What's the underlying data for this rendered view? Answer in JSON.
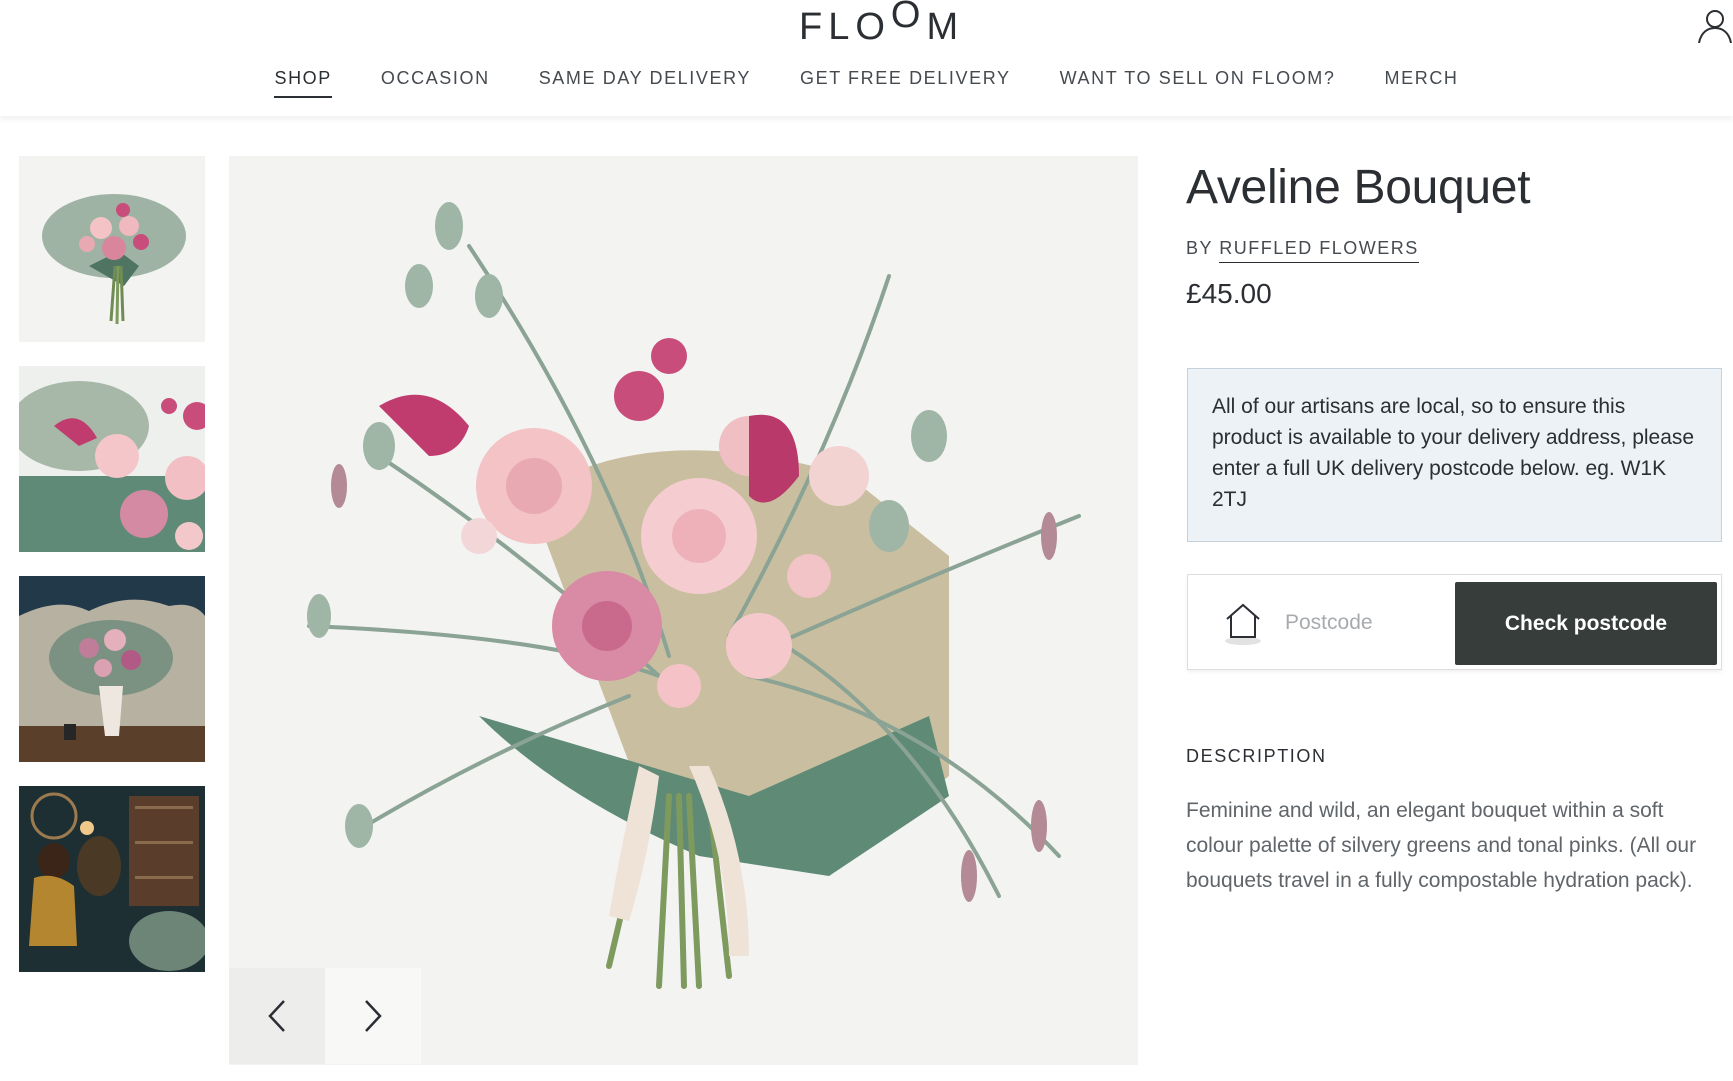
{
  "brand": {
    "logo_text": "FLOOM"
  },
  "nav": {
    "items": [
      {
        "label": "SHOP",
        "active": true
      },
      {
        "label": "OCCASION"
      },
      {
        "label": "SAME DAY DELIVERY"
      },
      {
        "label": "GET FREE DELIVERY"
      },
      {
        "label": "WANT TO SELL ON FLOOM?"
      },
      {
        "label": "MERCH"
      }
    ]
  },
  "header": {
    "account_icon": "user-icon"
  },
  "gallery": {
    "thumbnails": [
      {
        "subject": "bouquet on white background"
      },
      {
        "subject": "close-up of roses and carnations"
      },
      {
        "subject": "bouquet in styled interior with wall"
      },
      {
        "subject": "florist in flower shop"
      }
    ],
    "prev_icon": "chevron-left-icon",
    "next_icon": "chevron-right-icon"
  },
  "product": {
    "title": "Aveline Bouquet",
    "by_prefix": "BY",
    "seller": "RUFFLED FLOWERS",
    "price": "£45.00"
  },
  "delivery": {
    "notice": "All of our artisans are local, so to ensure this product is available to your delivery address, please enter a full UK delivery postcode below. eg. W1K 2TJ",
    "postcode_placeholder": "Postcode",
    "postcode_value": "",
    "check_label": "Check postcode",
    "home_icon": "home-icon"
  },
  "description": {
    "heading": "DESCRIPTION",
    "text": "Feminine and wild, an elegant bouquet within a soft colour palette of silvery greens and tonal pinks. (All our bouquets travel in a fully compostable hydration pack)."
  },
  "colors": {
    "text_dark": "#2b2f33",
    "button_bg": "#373d3a",
    "notice_bg": "#ecf2f6",
    "rose_pink": "#f3c3c6",
    "calla_magenta": "#b8396a",
    "foliage_green": "#7d9a86"
  }
}
